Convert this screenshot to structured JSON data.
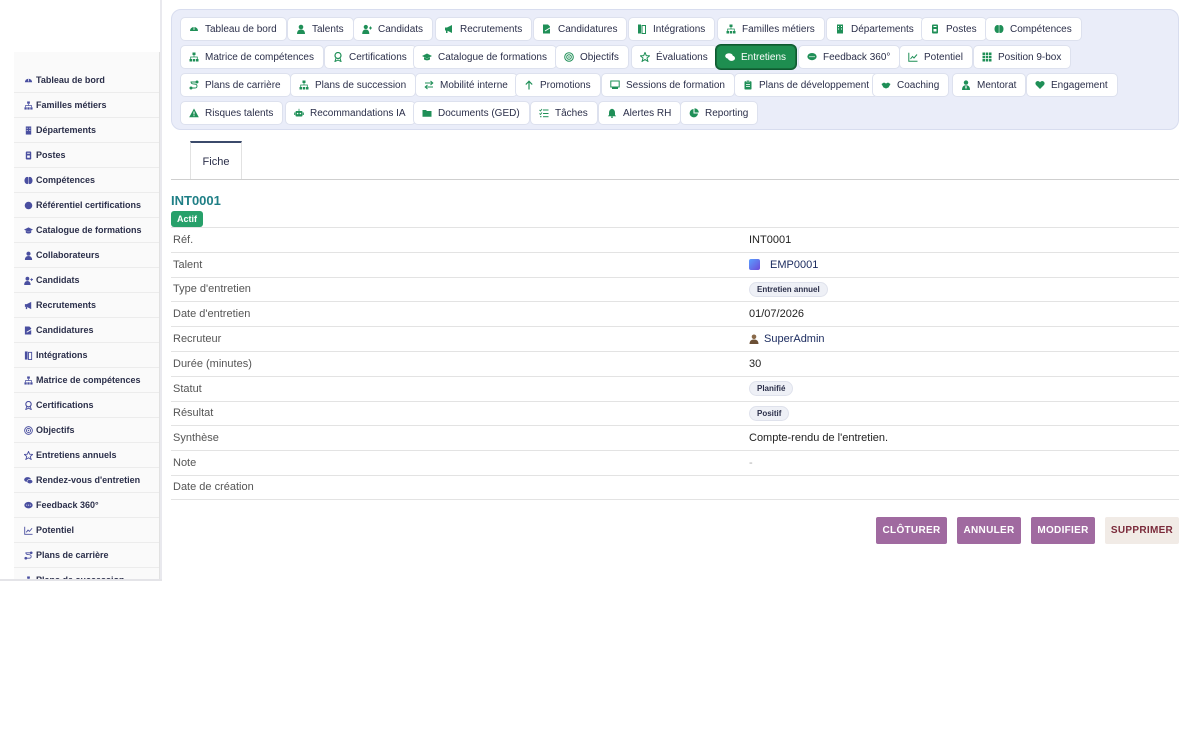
{
  "sidebar": {
    "items": [
      {
        "label": "Tableau de bord",
        "icon": "dashboard-icon"
      },
      {
        "label": "Familles métiers",
        "icon": "sitemap-icon"
      },
      {
        "label": "Départements",
        "icon": "building-icon"
      },
      {
        "label": "Postes",
        "icon": "badge-icon"
      },
      {
        "label": "Compétences",
        "icon": "brain-icon"
      },
      {
        "label": "Référentiel certifications",
        "icon": "certificate-icon"
      },
      {
        "label": "Catalogue de formations",
        "icon": "graduation-cap-icon"
      },
      {
        "label": "Collaborateurs",
        "icon": "user-icon"
      },
      {
        "label": "Candidats",
        "icon": "user-plus-icon"
      },
      {
        "label": "Recrutements",
        "icon": "megaphone-icon"
      },
      {
        "label": "Candidatures",
        "icon": "file-signature-icon"
      },
      {
        "label": "Intégrations",
        "icon": "door-icon"
      },
      {
        "label": "Matrice de compétences",
        "icon": "sitemap-icon"
      },
      {
        "label": "Certifications",
        "icon": "award-icon"
      },
      {
        "label": "Objectifs",
        "icon": "target-icon"
      },
      {
        "label": "Entretiens annuels",
        "icon": "star-icon"
      },
      {
        "label": "Rendez-vous d'entretien",
        "icon": "comments-icon"
      },
      {
        "label": "Feedback 360°",
        "icon": "comment-dots-icon"
      },
      {
        "label": "Potentiel",
        "icon": "chart-line-icon"
      },
      {
        "label": "Plans de carrière",
        "icon": "route-icon"
      },
      {
        "label": "Plans de succession",
        "icon": "sitemap-icon"
      }
    ]
  },
  "topnav": {
    "items": [
      {
        "label": "Tableau de bord",
        "icon": "dashboard-icon"
      },
      {
        "label": "Talents",
        "icon": "user-icon"
      },
      {
        "label": "Candidats",
        "icon": "user-plus-icon"
      },
      {
        "label": "Recrutements",
        "icon": "megaphone-icon"
      },
      {
        "label": "Candidatures",
        "icon": "file-signature-icon"
      },
      {
        "label": "Intégrations",
        "icon": "door-icon"
      },
      {
        "label": "Familles métiers",
        "icon": "sitemap-icon"
      },
      {
        "label": "Départements",
        "icon": "building-icon"
      },
      {
        "label": "Postes",
        "icon": "badge-icon"
      },
      {
        "label": "Compétences",
        "icon": "brain-icon"
      },
      {
        "label": "Matrice de compétences",
        "icon": "sitemap-icon"
      },
      {
        "label": "Certifications",
        "icon": "award-icon"
      },
      {
        "label": "Catalogue de formations",
        "icon": "graduation-cap-icon"
      },
      {
        "label": "Objectifs",
        "icon": "target-icon"
      },
      {
        "label": "Évaluations",
        "icon": "star-icon"
      },
      {
        "label": "Entretiens",
        "icon": "comments-icon",
        "active": true
      },
      {
        "label": "Feedback 360°",
        "icon": "comment-dots-icon"
      },
      {
        "label": "Potentiel",
        "icon": "chart-line-icon"
      },
      {
        "label": "Position 9-box",
        "icon": "grid-icon"
      },
      {
        "label": "Plans de carrière",
        "icon": "route-icon"
      },
      {
        "label": "Plans de succession",
        "icon": "sitemap-icon"
      },
      {
        "label": "Mobilité interne",
        "icon": "exchange-icon"
      },
      {
        "label": "Promotions",
        "icon": "arrow-up-icon"
      },
      {
        "label": "Sessions de formation",
        "icon": "chalkboard-icon"
      },
      {
        "label": "Plans de développement",
        "icon": "clipboard-icon"
      },
      {
        "label": "Coaching",
        "icon": "handshake-icon"
      },
      {
        "label": "Mentorat",
        "icon": "user-tie-icon"
      },
      {
        "label": "Engagement",
        "icon": "heart-icon"
      },
      {
        "label": "Risques talents",
        "icon": "warning-icon"
      },
      {
        "label": "Recommandations IA",
        "icon": "robot-icon"
      },
      {
        "label": "Documents (GED)",
        "icon": "folder-icon"
      },
      {
        "label": "Tâches",
        "icon": "tasks-icon"
      },
      {
        "label": "Alertes RH",
        "icon": "bell-icon"
      },
      {
        "label": "Reporting",
        "icon": "pie-chart-icon"
      }
    ]
  },
  "tabs": {
    "fiche": "Fiche"
  },
  "record": {
    "title": "INT0001",
    "status_badge": "Actif",
    "fields": [
      {
        "label": "Réf.",
        "value": "INT0001",
        "kind": "text"
      },
      {
        "label": "Talent",
        "value": "EMP0001",
        "kind": "talent"
      },
      {
        "label": "Type d'entretien",
        "value": "Entretien annuel",
        "kind": "chip"
      },
      {
        "label": "Date d'entretien",
        "value": "01/07/2026",
        "kind": "text"
      },
      {
        "label": "Recruteur",
        "value": "SuperAdmin",
        "kind": "user"
      },
      {
        "label": "Durée (minutes)",
        "value": "30",
        "kind": "text"
      },
      {
        "label": "Statut",
        "value": "Planifié",
        "kind": "chip"
      },
      {
        "label": "Résultat",
        "value": "Positif",
        "kind": "chip"
      },
      {
        "label": "Synthèse",
        "value": "Compte-rendu de l'entretien.",
        "kind": "text"
      },
      {
        "label": "Note",
        "value": "-",
        "kind": "muted"
      },
      {
        "label": "Date de création",
        "value": "",
        "kind": "text"
      }
    ]
  },
  "actions": {
    "close": "CLÔTURER",
    "cancel": "ANNULER",
    "edit": "MODIFIER",
    "delete": "SUPPRIMER"
  },
  "colors": {
    "accent_green": "#1e8e50",
    "title_teal": "#1f7f86",
    "action_purple": "#a06aa0",
    "badge_green": "#27a06a",
    "nav_bg": "#eaedf9"
  }
}
